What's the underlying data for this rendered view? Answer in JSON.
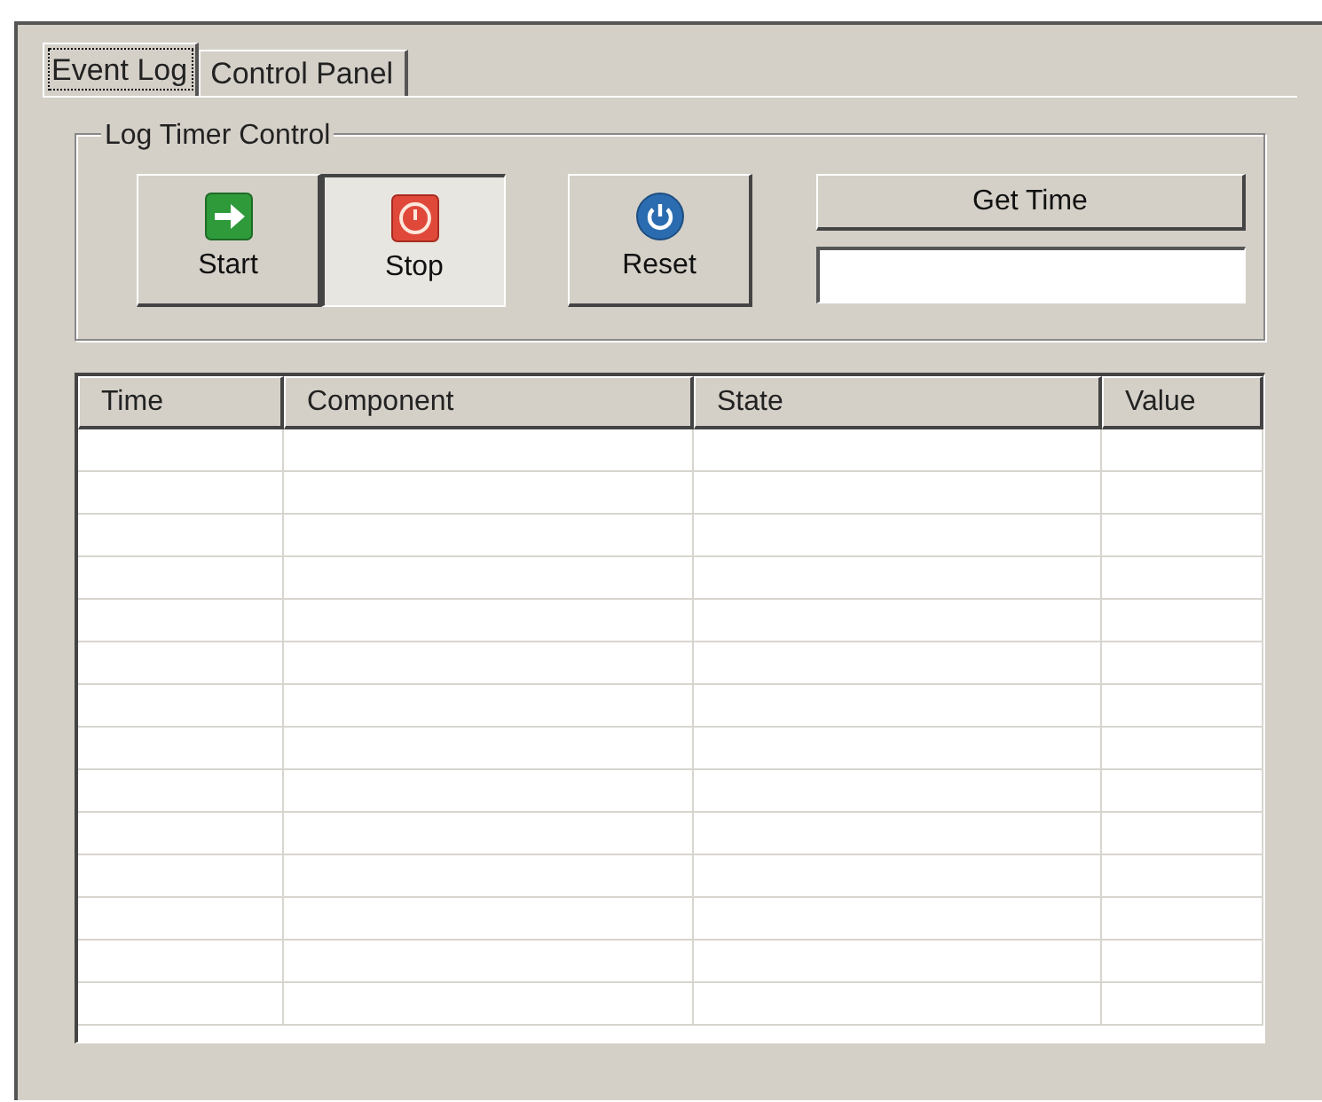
{
  "tabs": [
    {
      "label": "Event Log",
      "selected": true
    },
    {
      "label": "Control Panel",
      "selected": false
    }
  ],
  "group": {
    "title": "Log Timer Control",
    "buttons": [
      {
        "kind": "start",
        "label": "Start",
        "pressed": false
      },
      {
        "kind": "stop",
        "label": "Stop",
        "pressed": true
      },
      {
        "kind": "reset",
        "label": "Reset",
        "pressed": false
      }
    ],
    "get_time_button": "Get Time"
  },
  "table": {
    "columns": [
      "Time",
      "Component",
      "State",
      "Value"
    ]
  }
}
